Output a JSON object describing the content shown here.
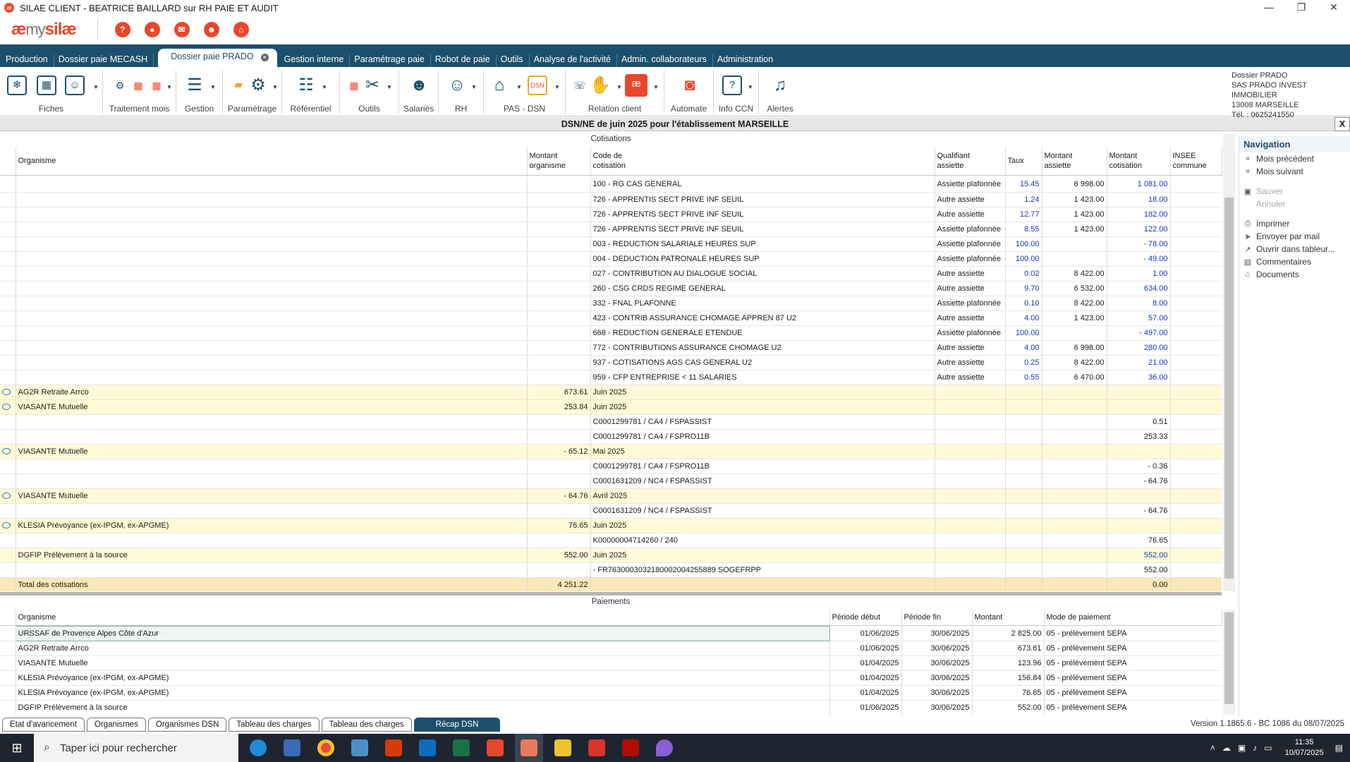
{
  "window": {
    "title": "SILAE CLIENT - BEATRICE BAILLARD sur RH PAIE ET AUDIT",
    "minimize": "—",
    "restore": "❐",
    "close": "✕"
  },
  "logo": {
    "part1": "æ",
    "part2": "my",
    "part3": "silæ"
  },
  "quick_icons": [
    "?",
    "●",
    "✉",
    "☻",
    "⌂"
  ],
  "menu": {
    "items": [
      "Production",
      "Dossier paie MECASH",
      "Dossier paie PRADO",
      "Gestion interne",
      "Paramétrage paie",
      "Robot de paie",
      "Outils",
      "Analyse de l'activité",
      "Admin. collaborateurs",
      "Administration"
    ],
    "active_index": 2
  },
  "toolbar": {
    "groups": [
      "Fiches",
      "Traitement mois",
      "Gestion",
      "Paramétrage",
      "Référentiel",
      "Outils",
      "Salariés",
      "RH",
      "PAS - DSN",
      "Relation client",
      "Automate",
      "Info CCN",
      "Alertes"
    ]
  },
  "dossier": {
    "line1": "Dossier PRADO",
    "line2": "SAS PRADO INVEST IMMOBILIER",
    "line3": "13008 MARSEILLE",
    "line4": "Tél. : 0625241550"
  },
  "page_title": "DSN/NE de juin 2025 pour l'établissement MARSEILLE",
  "close_label": "X",
  "cotisations": {
    "section_title": "Cotisations",
    "headers": {
      "organisme": "Organisme",
      "montant_org_1": "Montant",
      "montant_org_2": "organisme",
      "code_1": "Code de",
      "code_2": "cotisation",
      "qual_1": "Qualifiant",
      "qual_2": "assiette",
      "taux": "Taux",
      "massiette_1": "Montant",
      "massiette_2": "assiette",
      "mcot_1": "Montant",
      "mcot_2": "cotisation",
      "insee_1": "INSEE",
      "insee_2": "commune"
    },
    "rows": [
      {
        "type": "detail",
        "organisme": "",
        "montant_org": "",
        "code": "100 - RG CAS GENERAL",
        "qual": "Assiette plafonnée",
        "taux": "15.45",
        "assiette": "6 998.00",
        "cotisation": "1 081.00",
        "insee": ""
      },
      {
        "type": "detail",
        "organisme": "",
        "montant_org": "",
        "code": "726 - APPRENTIS SECT PRIVE INF SEUIL",
        "qual": "Autre assiette",
        "taux": "1.24",
        "assiette": "1 423.00",
        "cotisation": "18.00",
        "insee": ""
      },
      {
        "type": "detail",
        "organisme": "",
        "montant_org": "",
        "code": "726 - APPRENTIS SECT PRIVE INF SEUIL",
        "qual": "Autre assiette",
        "taux": "12.77",
        "assiette": "1 423.00",
        "cotisation": "182.00",
        "insee": ""
      },
      {
        "type": "detail",
        "organisme": "",
        "montant_org": "",
        "code": "726 - APPRENTIS SECT PRIVE INF SEUIL",
        "qual": "Assiette plafonnée",
        "taux": "8.55",
        "assiette": "1 423.00",
        "cotisation": "122.00",
        "insee": ""
      },
      {
        "type": "detail",
        "organisme": "",
        "montant_org": "",
        "code": "003 - REDUCTION SALARIALE HEURES SUP",
        "qual": "Assiette plafonnée",
        "taux": "100.00",
        "assiette": "",
        "cotisation": "- 78.00",
        "insee": ""
      },
      {
        "type": "detail",
        "organisme": "",
        "montant_org": "",
        "code": "004 - DEDUCTION PATRONALE HEURES SUP",
        "qual": "Assiette plafonnée",
        "taux": "100.00",
        "assiette": "",
        "cotisation": "- 49.00",
        "insee": ""
      },
      {
        "type": "detail",
        "organisme": "",
        "montant_org": "",
        "code": "027 - CONTRIBUTION AU DIALOGUE SOCIAL",
        "qual": "Autre assiette",
        "taux": "0.02",
        "assiette": "8 422.00",
        "cotisation": "1.00",
        "insee": ""
      },
      {
        "type": "detail",
        "organisme": "",
        "montant_org": "",
        "code": "260 - CSG CRDS REGIME GENERAL",
        "qual": "Autre assiette",
        "taux": "9.70",
        "assiette": "6 532.00",
        "cotisation": "634.00",
        "insee": ""
      },
      {
        "type": "detail",
        "organisme": "",
        "montant_org": "",
        "code": "332 - FNAL PLAFONNE",
        "qual": "Assiette plafonnée",
        "taux": "0.10",
        "assiette": "8 422.00",
        "cotisation": "8.00",
        "insee": ""
      },
      {
        "type": "detail",
        "organisme": "",
        "montant_org": "",
        "code": "423 - CONTRIB ASSURANCE CHOMAGE APPREN 87 U2",
        "qual": "Autre assiette",
        "taux": "4.00",
        "assiette": "1 423.00",
        "cotisation": "57.00",
        "insee": ""
      },
      {
        "type": "detail",
        "organisme": "",
        "montant_org": "",
        "code": "668 - REDUCTION GENERALE ETENDUE",
        "qual": "Assiette plafonnée",
        "taux": "100.00",
        "assiette": "",
        "cotisation": "- 497.00",
        "insee": ""
      },
      {
        "type": "detail",
        "organisme": "",
        "montant_org": "",
        "code": "772 - CONTRIBUTIONS ASSURANCE CHOMAGE U2",
        "qual": "Autre assiette",
        "taux": "4.00",
        "assiette": "6 998.00",
        "cotisation": "280.00",
        "insee": ""
      },
      {
        "type": "detail",
        "organisme": "",
        "montant_org": "",
        "code": "937 - COTISATIONS AGS CAS GENERAL U2",
        "qual": "Autre assiette",
        "taux": "0.25",
        "assiette": "8 422.00",
        "cotisation": "21.00",
        "insee": ""
      },
      {
        "type": "detail",
        "organisme": "",
        "montant_org": "",
        "code": "959 - CFP ENTREPRISE < 11 SALARIES",
        "qual": "Autre assiette",
        "taux": "0.55",
        "assiette": "6 470.00",
        "cotisation": "36.00",
        "insee": ""
      },
      {
        "type": "org",
        "bubble": true,
        "organisme": "AG2R Retraite Arrco",
        "montant_org": "673.61",
        "code": "Juin 2025",
        "qual": "",
        "taux": "",
        "assiette": "",
        "cotisation": "",
        "insee": ""
      },
      {
        "type": "org",
        "bubble": true,
        "organisme": "VIASANTE Mutuelle",
        "montant_org": "253.84",
        "code": "Juin 2025",
        "qual": "",
        "taux": "",
        "assiette": "",
        "cotisation": "",
        "insee": ""
      },
      {
        "type": "detail",
        "organisme": "",
        "montant_org": "",
        "code": "C0001299781 / CA4 / FSPASSIST",
        "qual": "",
        "taux": "",
        "assiette": "",
        "cotisation": "0.51",
        "insee": "",
        "plain": true
      },
      {
        "type": "detail",
        "organisme": "",
        "montant_org": "",
        "code": "C0001299781 / CA4 / FSPRO11B",
        "qual": "",
        "taux": "",
        "assiette": "",
        "cotisation": "253.33",
        "insee": "",
        "plain": true
      },
      {
        "type": "org",
        "bubble": true,
        "organisme": "VIASANTE Mutuelle",
        "montant_org": "- 65.12",
        "code": "Mai 2025",
        "qual": "",
        "taux": "",
        "assiette": "",
        "cotisation": "",
        "insee": ""
      },
      {
        "type": "detail",
        "organisme": "",
        "montant_org": "",
        "code": "C0001299781 / CA4 / FSPRO11B",
        "qual": "",
        "taux": "",
        "assiette": "",
        "cotisation": "- 0.36",
        "insee": "",
        "plain": true
      },
      {
        "type": "detail",
        "organisme": "",
        "montant_org": "",
        "code": "C0001631209 / NC4 / FSPASSIST",
        "qual": "",
        "taux": "",
        "assiette": "",
        "cotisation": "- 64.76",
        "insee": "",
        "plain": true
      },
      {
        "type": "org",
        "bubble": true,
        "organisme": "VIASANTE Mutuelle",
        "montant_org": "- 64.76",
        "code": "Avril 2025",
        "qual": "",
        "taux": "",
        "assiette": "",
        "cotisation": "",
        "insee": ""
      },
      {
        "type": "detail",
        "organisme": "",
        "montant_org": "",
        "code": "C0001631209 / NC4 / FSPASSIST",
        "qual": "",
        "taux": "",
        "assiette": "",
        "cotisation": "- 64.76",
        "insee": "",
        "plain": true
      },
      {
        "type": "org",
        "bubble": true,
        "organisme": "KLESIA Prévoyance (ex-IPGM, ex-APGME)",
        "montant_org": "76.65",
        "code": "Juin 2025",
        "qual": "",
        "taux": "",
        "assiette": "",
        "cotisation": "",
        "insee": ""
      },
      {
        "type": "detail",
        "organisme": "",
        "montant_org": "",
        "code": "K00000004714260 / 240",
        "qual": "",
        "taux": "",
        "assiette": "",
        "cotisation": "76.65",
        "insee": "",
        "plain": true
      },
      {
        "type": "org",
        "bubble": false,
        "organisme": "DGFIP Prélèvement à la source",
        "montant_org": "552.00",
        "code": "Juin 2025",
        "qual": "",
        "taux": "",
        "assiette": "",
        "cotisation": "552.00",
        "insee": ""
      },
      {
        "type": "detail",
        "organisme": "",
        "montant_org": "",
        "code": " - FR7630003032180002004255889 SOGEFRPP",
        "qual": "",
        "taux": "",
        "assiette": "",
        "cotisation": "552.00",
        "insee": "",
        "plain": true
      },
      {
        "type": "tot",
        "organisme": "Total des cotisations",
        "montant_org": "4 251.22",
        "code": "",
        "qual": "",
        "taux": "",
        "assiette": "",
        "cotisation": "0.00",
        "insee": ""
      }
    ]
  },
  "paiements": {
    "section_title": "Paiements",
    "headers": {
      "organisme": "Organisme",
      "debut": "Période début",
      "fin": "Période fin",
      "montant": "Montant",
      "mode": "Mode de paiement"
    },
    "rows": [
      {
        "organisme": "URSSAF de Provence Alpes Côte d'Azur",
        "debut": "01/06/2025",
        "fin": "30/06/2025",
        "montant": "2 825.00",
        "mode": "05 - prélèvement SEPA"
      },
      {
        "organisme": "AG2R Retraite Arrco",
        "debut": "01/06/2025",
        "fin": "30/06/2025",
        "montant": "673.61",
        "mode": "05 - prélèvement SEPA"
      },
      {
        "organisme": "VIASANTE Mutuelle",
        "debut": "01/04/2025",
        "fin": "30/06/2025",
        "montant": "123.96",
        "mode": "05 - prélèvement SEPA"
      },
      {
        "organisme": "KLESIA Prévoyance (ex-IPGM, ex-APGME)",
        "debut": "01/04/2025",
        "fin": "30/06/2025",
        "montant": "156.84",
        "mode": "05 - prélèvement SEPA"
      },
      {
        "organisme": "KLESIA Prévoyance (ex-IPGM, ex-APGME)",
        "debut": "01/04/2025",
        "fin": "30/06/2025",
        "montant": "76.65",
        "mode": "05 - prélèvement SEPA"
      },
      {
        "organisme": "DGFIP Prélèvement à la source",
        "debut": "01/06/2025",
        "fin": "30/06/2025",
        "montant": "552.00",
        "mode": "05 - prélèvement SEPA"
      }
    ]
  },
  "navigation": {
    "title": "Navigation",
    "items": [
      {
        "label": "Mois précédent",
        "glyph": "«",
        "disabled": false
      },
      {
        "label": "Mois suivant",
        "glyph": "»",
        "disabled": false
      },
      {
        "sep": true
      },
      {
        "label": "Sauver",
        "glyph": "▣",
        "disabled": true
      },
      {
        "label": "Annuler",
        "glyph": "",
        "disabled": true
      },
      {
        "sep": true
      },
      {
        "label": "Imprimer",
        "glyph": "⎙",
        "disabled": false
      },
      {
        "label": "Envoyer par mail",
        "glyph": "➤",
        "disabled": false
      },
      {
        "label": "Ouvrir dans tableur...",
        "glyph": "↗",
        "disabled": false
      },
      {
        "label": "Commentaires",
        "glyph": "▤",
        "disabled": false
      },
      {
        "label": "Documents",
        "glyph": "⌂",
        "disabled": false
      }
    ]
  },
  "bottom_tabs": [
    "Etat d'avancement",
    "Organismes",
    "Organismes DSN",
    "Tableau des charges",
    "Tableau des charges",
    "Récap DSN"
  ],
  "bottom_tabs_active": 5,
  "version": "Version 1.1865.6 - BC 1086 du 08/07/2025",
  "taskbar": {
    "search": "Taper ici pour rechercher",
    "time": "11:35",
    "date": "10/07/2025"
  },
  "colors": {
    "brand": "#e8472b",
    "nav": "#1c4f6c",
    "amount": "#1a36b4",
    "org_row": "#fffbd6",
    "total_row": "#fbe8b8"
  }
}
